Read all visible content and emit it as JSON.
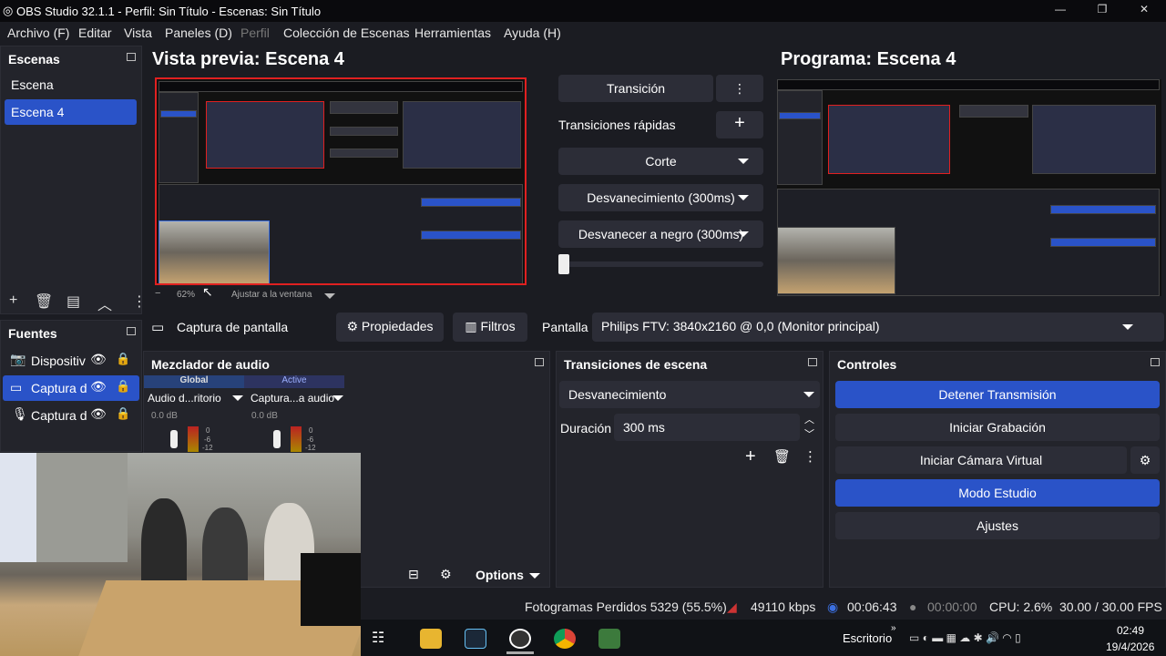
{
  "window": {
    "title": "OBS Studio 32.1.1 - Perfil: Sin Título - Escenas: Sin Título"
  },
  "menu": [
    "Archivo (F)",
    "Editar",
    "Vista",
    "Paneles (D)",
    "Perfil",
    "Colección de Escenas",
    "Herramientas",
    "Ayuda (H)"
  ],
  "scenes": {
    "title": "Escenas",
    "items": [
      "Escena",
      "Escena 4"
    ],
    "selected": 1
  },
  "preview": {
    "title": "Vista previa: Escena 4",
    "zoom": "62%",
    "fit": "Ajustar a la ventana"
  },
  "program": {
    "title": "Programa: Escena 4"
  },
  "transition_panel": {
    "transition": "Transición",
    "quick": "Transiciones rápidas",
    "items": [
      "Corte",
      "Desvanecimiento (300ms)",
      "Desvanecer a negro (300ms)"
    ]
  },
  "sources": {
    "title": "Fuentes",
    "items": [
      "Dispositiv",
      "Captura d",
      "Captura d"
    ]
  },
  "source_toolbar": {
    "name": "Captura de pantalla",
    "properties": "Propiedades",
    "filters": "Filtros",
    "display_label": "Pantalla",
    "display_value": "Philips FTV: 3840x2160 @ 0,0 (Monitor principal)"
  },
  "mixer": {
    "title": "Mezclador de audio",
    "channels": [
      {
        "header": "Global",
        "name": "Audio d...ritorio",
        "db": "0.0 dB"
      },
      {
        "header": "Active",
        "name": "Captura...a audio",
        "db": "0.0 dB"
      }
    ],
    "scale": [
      "0",
      "-6",
      "-12"
    ],
    "options": "Options"
  },
  "scene_transitions": {
    "title": "Transiciones de escena",
    "type": "Desvanecimiento",
    "duration_label": "Duración",
    "duration": "300 ms"
  },
  "controls": {
    "title": "Controles",
    "buttons": [
      "Detener Transmisión",
      "Iniciar Grabación",
      "Iniciar Cámara Virtual",
      "Modo Estudio",
      "Ajustes"
    ]
  },
  "status": {
    "dropped": "Fotogramas Perdidos 5329 (55.5%)",
    "bitrate": "49110 kbps",
    "stream_time": "00:06:43",
    "rec_time": "00:00:00",
    "cpu": "CPU: 2.6%",
    "fps": "30.00 / 30.00 FPS"
  },
  "taskbar": {
    "desktop": "Escritorio",
    "time": "02:49",
    "date": "19/4/2026"
  },
  "colors": {
    "accent": "#2a53c8",
    "bg": "#1b1c22",
    "panel": "#23242b",
    "preview_border": "#e02020"
  }
}
